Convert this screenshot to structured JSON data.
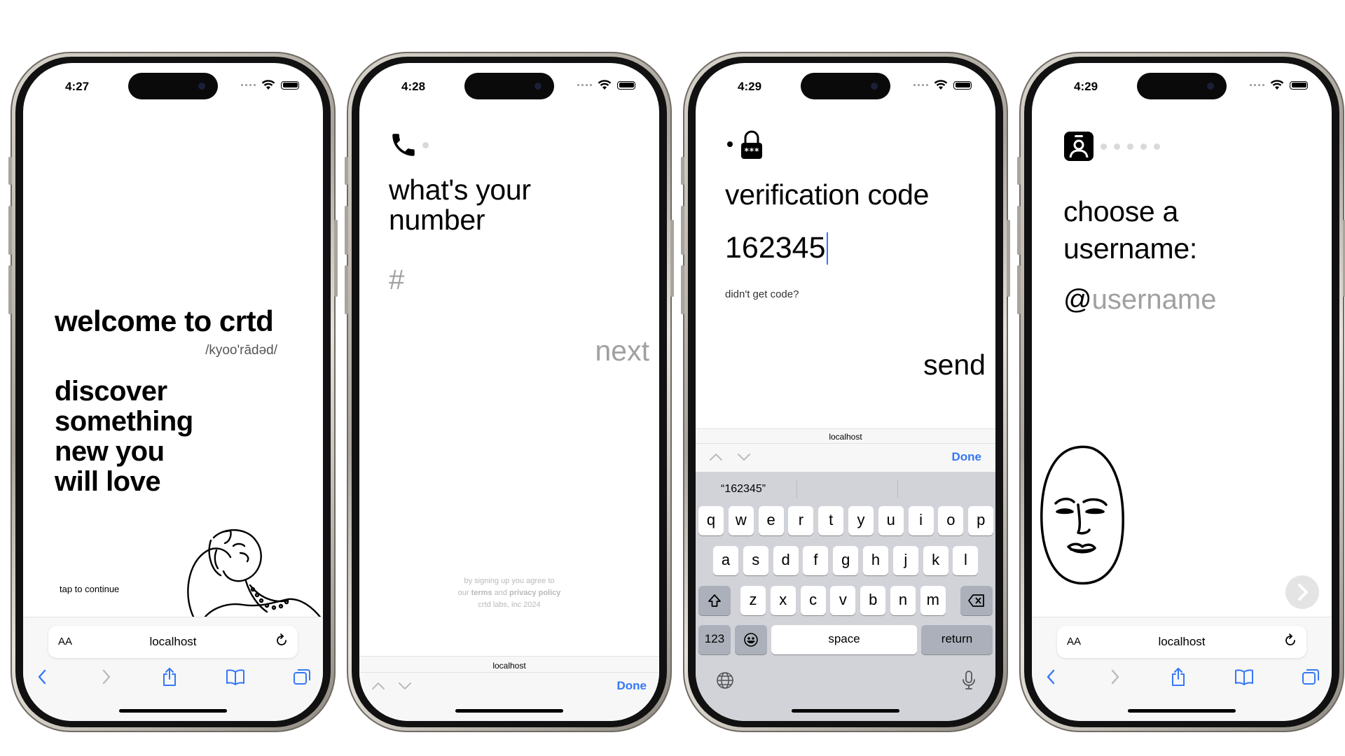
{
  "screens": [
    {
      "time": "4:27",
      "welcome_title": "welcome to crtd",
      "pronunciation": "/kyoo'rādəd/",
      "tagline_lines": [
        "discover",
        "something",
        "new you",
        "will love"
      ],
      "tap_to_continue": "tap to continue",
      "safari": {
        "text_size_label": "AA",
        "host": "localhost"
      }
    },
    {
      "time": "4:28",
      "title_lines": [
        "what's your",
        "number"
      ],
      "phone_placeholder": "#",
      "next_label": "next",
      "legal": {
        "line1": "by signing up you agree to",
        "our": "our",
        "terms": "terms",
        "and": "and",
        "privacy": "privacy policy",
        "copyright": "crtd labs, inc 2024"
      },
      "accessory": {
        "host": "localhost",
        "done_label": "Done"
      }
    },
    {
      "time": "4:29",
      "title": "verification code",
      "code_value": "162345",
      "resend_label": "didn't get code?",
      "send_label": "send",
      "accessory": {
        "host": "localhost",
        "done_label": "Done"
      },
      "keyboard": {
        "suggestion": "“162345”",
        "rows": [
          [
            "q",
            "w",
            "e",
            "r",
            "t",
            "y",
            "u",
            "i",
            "o",
            "p"
          ],
          [
            "a",
            "s",
            "d",
            "f",
            "g",
            "h",
            "j",
            "k",
            "l"
          ],
          [
            "z",
            "x",
            "c",
            "v",
            "b",
            "n",
            "m"
          ]
        ],
        "numbers_label": "123",
        "space_label": "space",
        "return_label": "return"
      }
    },
    {
      "time": "4:29",
      "title_lines": [
        "choose a",
        "username:"
      ],
      "at_sign": "@",
      "username_placeholder": "username",
      "safari": {
        "text_size_label": "AA",
        "host": "localhost"
      }
    }
  ],
  "colors": {
    "accent": "#3478f6",
    "placeholder": "#a0a0a0",
    "keyboard_bg": "#d1d3d9"
  }
}
